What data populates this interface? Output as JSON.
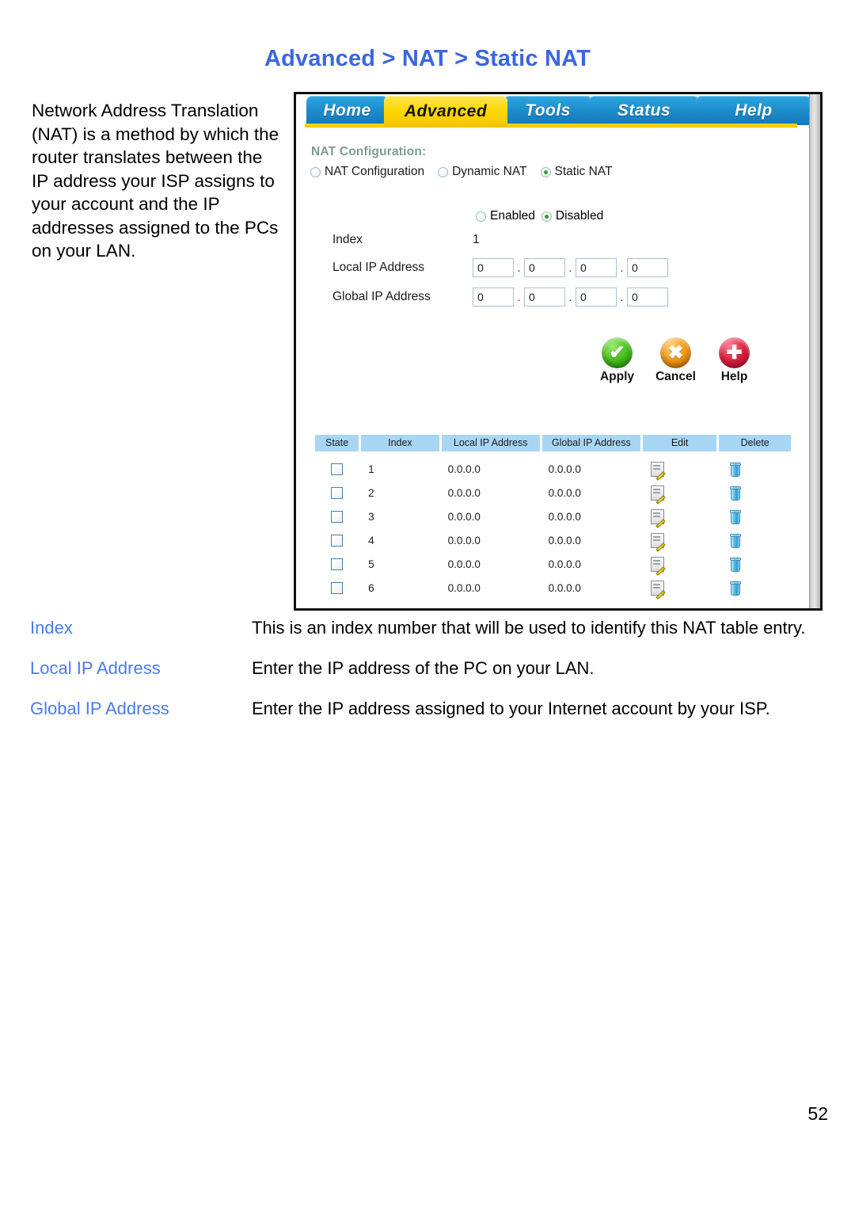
{
  "page_title": "Advanced > NAT > Static NAT",
  "intro_paragraph": "Network Address Translation (NAT) is a method by which the router translates between the IP address your ISP assigns to your account and the IP addresses assigned to the PCs on your LAN.",
  "page_number": "52",
  "colors": {
    "title_blue": "#3a66e0",
    "term_blue": "#4a7bea",
    "tab_active_yellow": "#ffd800",
    "tab_inactive_blue": "#1e8ecd",
    "table_header_blue": "#a7d6f5",
    "section_label": "#7e9b93"
  },
  "router_ui": {
    "tabs": [
      {
        "label": "Home",
        "active": false
      },
      {
        "label": "Advanced",
        "active": true
      },
      {
        "label": "Tools",
        "active": false
      },
      {
        "label": "Status",
        "active": false
      },
      {
        "label": "Help",
        "active": false
      }
    ],
    "section_label": "NAT Configuration:",
    "mode_radios": [
      {
        "label": "NAT Configuration",
        "selected": false
      },
      {
        "label": "Dynamic NAT",
        "selected": false
      },
      {
        "label": "Static NAT",
        "selected": true
      }
    ],
    "state_radios": [
      {
        "label": "Enabled",
        "selected": false
      },
      {
        "label": "Disabled",
        "selected": true
      }
    ],
    "fields": {
      "index_label": "Index",
      "index_value": "1",
      "local_label": "Local IP Address",
      "local_octets": [
        "0",
        "0",
        "0",
        "0"
      ],
      "global_label": "Global IP Address",
      "global_octets": [
        "0",
        "0",
        "0",
        "0"
      ]
    },
    "actions": [
      {
        "label": "Apply",
        "icon": "check-icon",
        "glyph": "✔"
      },
      {
        "label": "Cancel",
        "icon": "x-icon",
        "glyph": "✖"
      },
      {
        "label": "Help",
        "icon": "plus-icon",
        "glyph": "✚"
      }
    ],
    "table": {
      "headers": [
        "State",
        "Index",
        "Local IP Address",
        "Global IP Address",
        "Edit",
        "Delete"
      ],
      "rows": [
        {
          "state": false,
          "index": "1",
          "local": "0.0.0.0",
          "global": "0.0.0.0"
        },
        {
          "state": false,
          "index": "2",
          "local": "0.0.0.0",
          "global": "0.0.0.0"
        },
        {
          "state": false,
          "index": "3",
          "local": "0.0.0.0",
          "global": "0.0.0.0"
        },
        {
          "state": false,
          "index": "4",
          "local": "0.0.0.0",
          "global": "0.0.0.0"
        },
        {
          "state": false,
          "index": "5",
          "local": "0.0.0.0",
          "global": "0.0.0.0"
        },
        {
          "state": false,
          "index": "6",
          "local": "0.0.0.0",
          "global": "0.0.0.0"
        }
      ]
    }
  },
  "definitions": [
    {
      "term": "Index",
      "description": "This is an index number that will be used to identify this NAT table entry."
    },
    {
      "term": "Local IP Address",
      "description": "Enter the IP address of the PC on your LAN."
    },
    {
      "term": "Global IP Address",
      "description": "Enter the IP address assigned to your Internet account by your ISP."
    }
  ]
}
